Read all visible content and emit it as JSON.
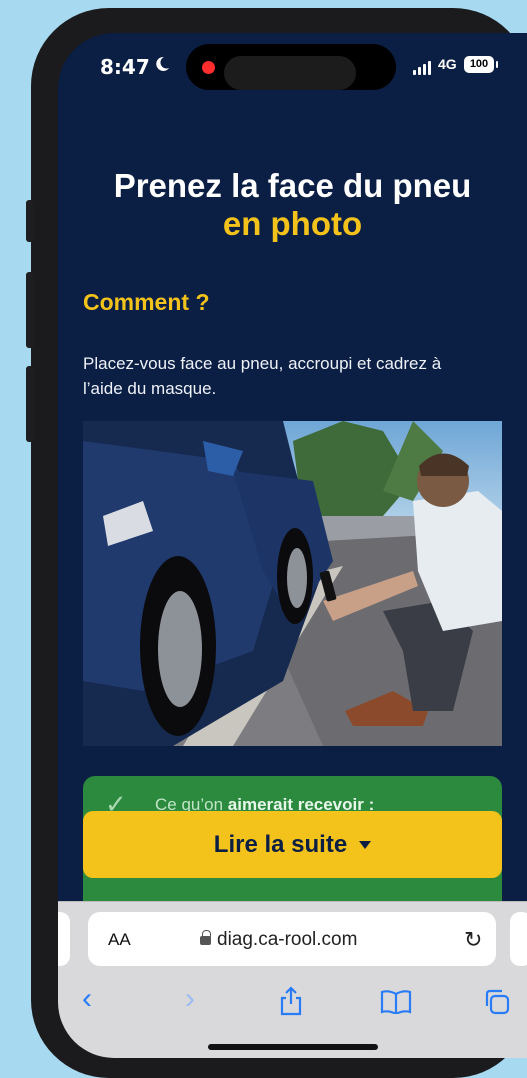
{
  "status_bar": {
    "time": "8:47",
    "network": "4G",
    "battery": "100"
  },
  "page": {
    "title_line1": "Prenez la face du pneu",
    "title_line2": "en photo",
    "section_heading": "Comment ?",
    "description": "Placez-vous face au pneu, accroupi et cadrez à l’aide du masque.",
    "photo_icon": "photo-illustration",
    "callout": {
      "prefix": "Ce qu’on ",
      "bold": "aimerait recevoir :"
    },
    "read_more_label": "Lire la suite"
  },
  "browser": {
    "aa_label": "AA",
    "url": "diag.ca-rool.com"
  },
  "colors": {
    "background": "#0b1e44",
    "accent": "#f3c21b",
    "green": "#2b8a3e",
    "ios_blue": "#2a7cf6"
  }
}
